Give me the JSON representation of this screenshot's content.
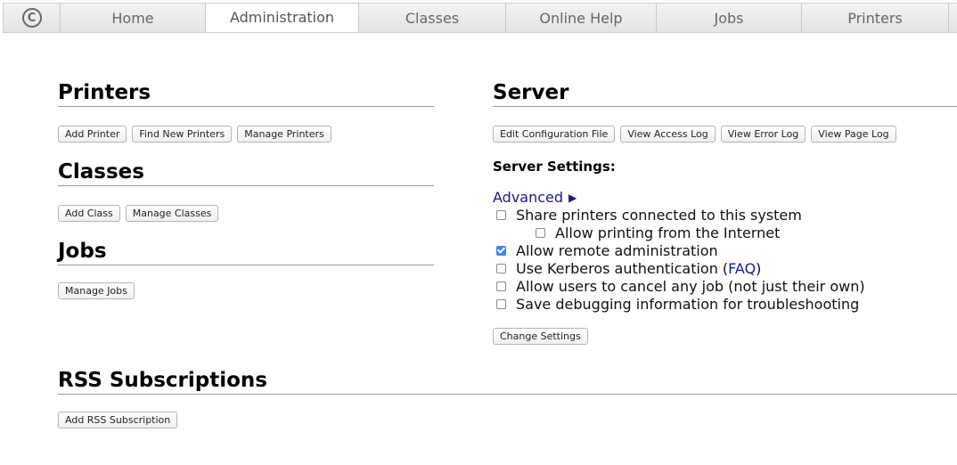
{
  "tabs": [
    {
      "label": "Home",
      "active": false
    },
    {
      "label": "Administration",
      "active": true
    },
    {
      "label": "Classes",
      "active": false
    },
    {
      "label": "Online Help",
      "active": false
    },
    {
      "label": "Jobs",
      "active": false
    },
    {
      "label": "Printers",
      "active": false
    }
  ],
  "logo_glyph": "C",
  "printers": {
    "title": "Printers",
    "buttons": [
      "Add Printer",
      "Find New Printers",
      "Manage Printers"
    ]
  },
  "classes": {
    "title": "Classes",
    "buttons": [
      "Add Class",
      "Manage Classes"
    ]
  },
  "jobs": {
    "title": "Jobs",
    "buttons": [
      "Manage Jobs"
    ]
  },
  "rss": {
    "title": "RSS Subscriptions",
    "buttons": [
      "Add RSS Subscription"
    ]
  },
  "server": {
    "title": "Server",
    "buttons": [
      "Edit Configuration File",
      "View Access Log",
      "View Error Log",
      "View Page Log"
    ],
    "settings_title": "Server Settings:",
    "advanced_label": "Advanced",
    "advanced_arrow": "▶",
    "options": {
      "share": {
        "label": "Share printers connected to this system",
        "checked": false
      },
      "internet": {
        "label": "Allow printing from the Internet",
        "checked": false
      },
      "remote_admin": {
        "label": "Allow remote administration",
        "checked": true
      },
      "kerberos": {
        "label_before": "Use Kerberos authentication (",
        "link": "FAQ",
        "label_after": ")",
        "checked": false
      },
      "cancel_jobs": {
        "label": "Allow users to cancel any job (not just their own)",
        "checked": false
      },
      "debug": {
        "label": "Save debugging information for troubleshooting",
        "checked": false
      }
    },
    "change_settings_label": "Change Settings"
  },
  "colors": {
    "link": "#1a1a8c",
    "checkbox_checked": "#3b86f4"
  }
}
